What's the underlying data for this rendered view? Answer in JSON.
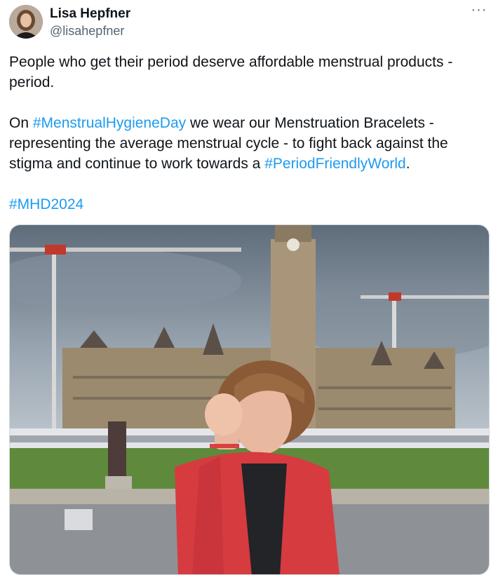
{
  "author": {
    "name": "Lisa Hepfner",
    "handle": "@lisahepfner"
  },
  "menu": {
    "icon": "more-horizontal-icon",
    "glyph": "···"
  },
  "tweet": {
    "line1": "People who get their period deserve affordable menstrual products -",
    "line2": "period.",
    "p2_prefix": "On ",
    "hashtag1": "#MenstrualHygieneDay",
    "p2_mid": " we wear our Menstruation Bracelets - representing the average menstrual cycle - to fight back against the stigma and continue to work towards a ",
    "hashtag2": "#PeriodFriendlyWorld",
    "p2_suffix": ".",
    "hashtag3": "#MHD2024"
  },
  "colors": {
    "link": "#1d9bf0",
    "text": "#0f1419",
    "secondary": "#536471"
  }
}
